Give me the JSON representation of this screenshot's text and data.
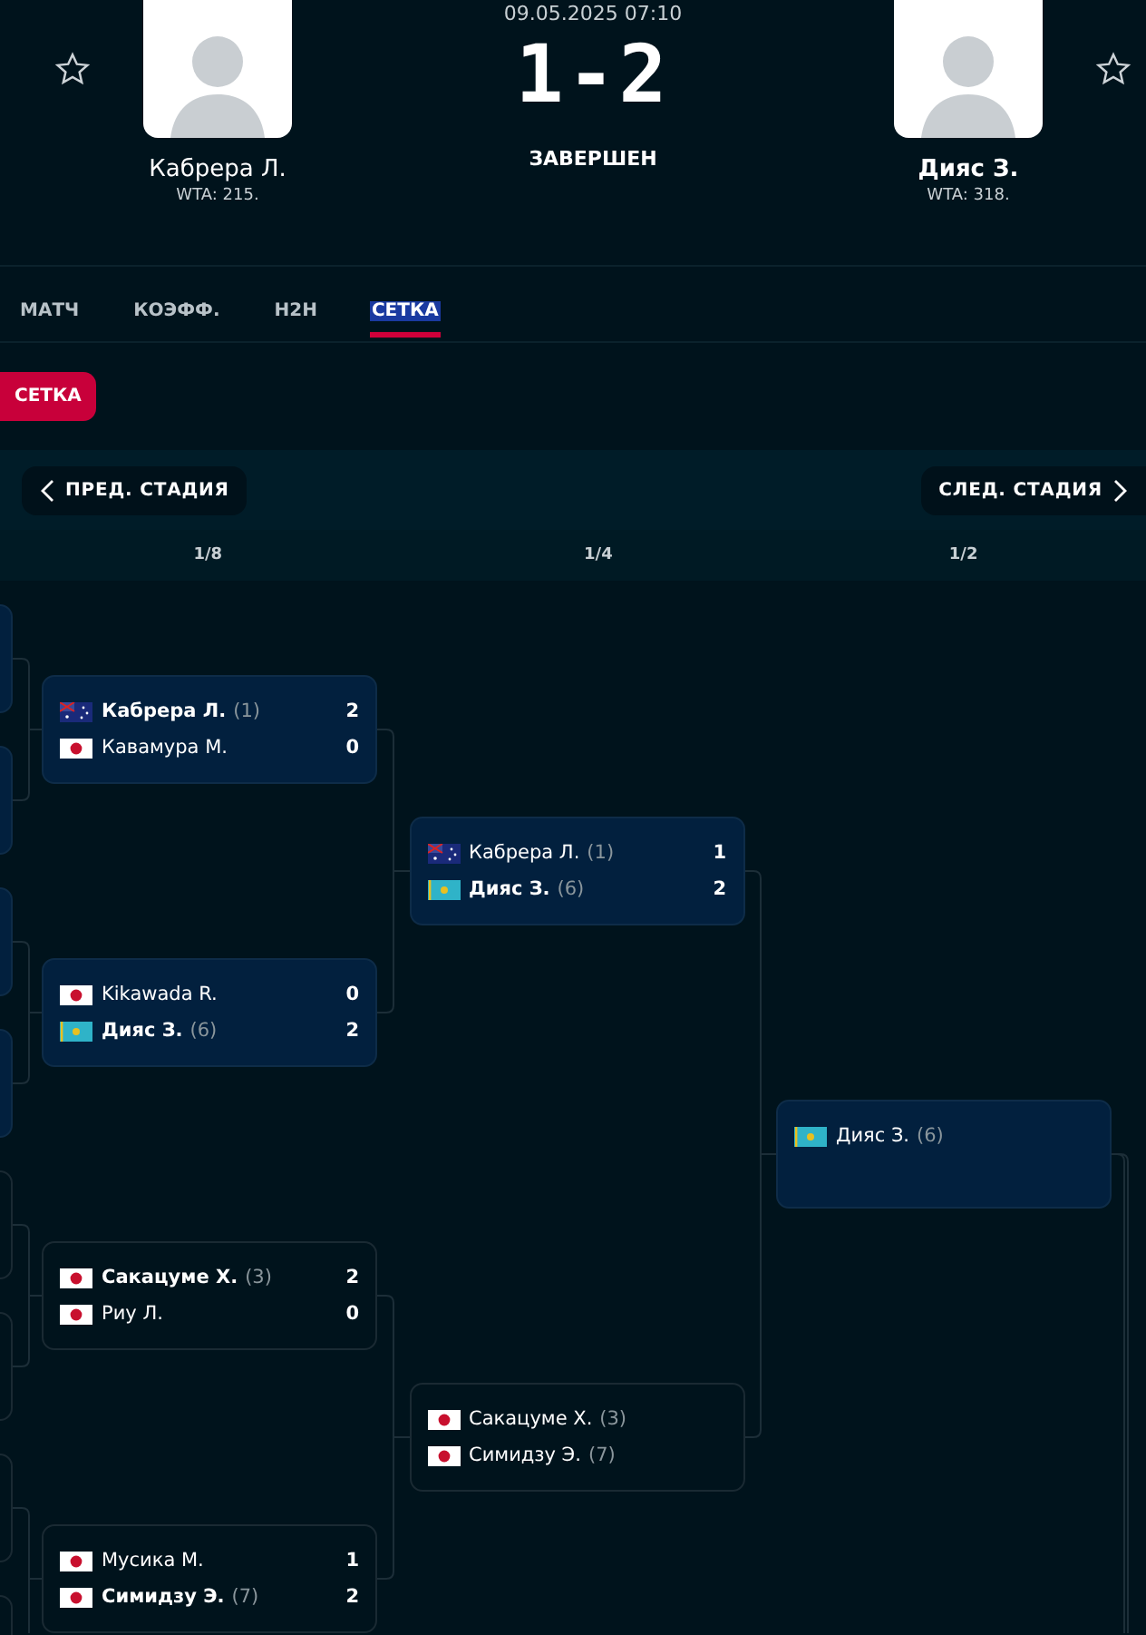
{
  "match": {
    "date": "09.05.2025 07:10",
    "score": "1-2",
    "status": "ЗАВЕРШЕН",
    "players": [
      {
        "name": "Кабрера Л.",
        "rank": "WTA: 215.",
        "winner": false,
        "favorite": false
      },
      {
        "name": "Дияс З.",
        "rank": "WTA: 318.",
        "winner": true,
        "favorite": false
      }
    ]
  },
  "tabs": [
    {
      "label": "МАТЧ",
      "selected": false
    },
    {
      "label": "КОЭФФ.",
      "selected": false
    },
    {
      "label": "H2H",
      "selected": false
    },
    {
      "label": "СЕТКА",
      "selected": true
    }
  ],
  "filter": {
    "label": "СЕТКА"
  },
  "stage_nav": {
    "prev": "ПРЕД. СТАДИЯ",
    "next": "СЛЕД. СТАДИЯ"
  },
  "rounds": [
    {
      "label": "1/8",
      "matches": [
        {
          "highlighted": true,
          "players": [
            {
              "flag": {
                "kind": "au"
              },
              "name": "Кабрера Л.",
              "seed": "(1)",
              "score": "2",
              "winner": true
            },
            {
              "flag": {
                "kind": "jp"
              },
              "name": "Кавамура М.",
              "score": "0",
              "winner": false
            }
          ]
        },
        {
          "highlighted": true,
          "players": [
            {
              "flag": {
                "kind": "jp"
              },
              "name": "Kikawada R.",
              "score": "0",
              "winner": false
            },
            {
              "flag": {
                "kind": "kz"
              },
              "name": "Дияс З.",
              "seed": "(6)",
              "score": "2",
              "winner": true
            }
          ]
        },
        {
          "highlighted": false,
          "players": [
            {
              "flag": {
                "kind": "jp"
              },
              "name": "Сакацуме Х.",
              "seed": "(3)",
              "score": "2",
              "winner": true
            },
            {
              "flag": {
                "kind": "jp"
              },
              "name": "Риу Л.",
              "score": "0",
              "winner": false
            }
          ]
        },
        {
          "highlighted": false,
          "players": [
            {
              "flag": {
                "kind": "jp"
              },
              "name": "Мусика М.",
              "score": "1",
              "winner": false
            },
            {
              "flag": {
                "kind": "jp"
              },
              "name": "Симидзу Э.",
              "seed": "(7)",
              "score": "2",
              "winner": true
            }
          ]
        }
      ]
    },
    {
      "label": "1/4",
      "matches": [
        {
          "highlighted": true,
          "players": [
            {
              "flag": {
                "kind": "au"
              },
              "name": "Кабрера Л.",
              "seed": "(1)",
              "score": "1",
              "winner": false
            },
            {
              "flag": {
                "kind": "kz"
              },
              "name": "Дияс З.",
              "seed": "(6)",
              "score": "2",
              "winner": true
            }
          ]
        },
        {
          "highlighted": false,
          "players": [
            {
              "flag": {
                "kind": "jp"
              },
              "name": "Сакацуме Х.",
              "seed": "(3)",
              "winner": false
            },
            {
              "flag": {
                "kind": "jp"
              },
              "name": "Симидзу Э.",
              "seed": "(7)",
              "winner": false
            }
          ]
        }
      ]
    },
    {
      "label": "1/2",
      "matches": [
        {
          "highlighted": true,
          "players": [
            {
              "flag": {
                "kind": "kz"
              },
              "name": "Дияс З.",
              "seed": "(6)",
              "winner": false
            }
          ]
        }
      ]
    }
  ]
}
